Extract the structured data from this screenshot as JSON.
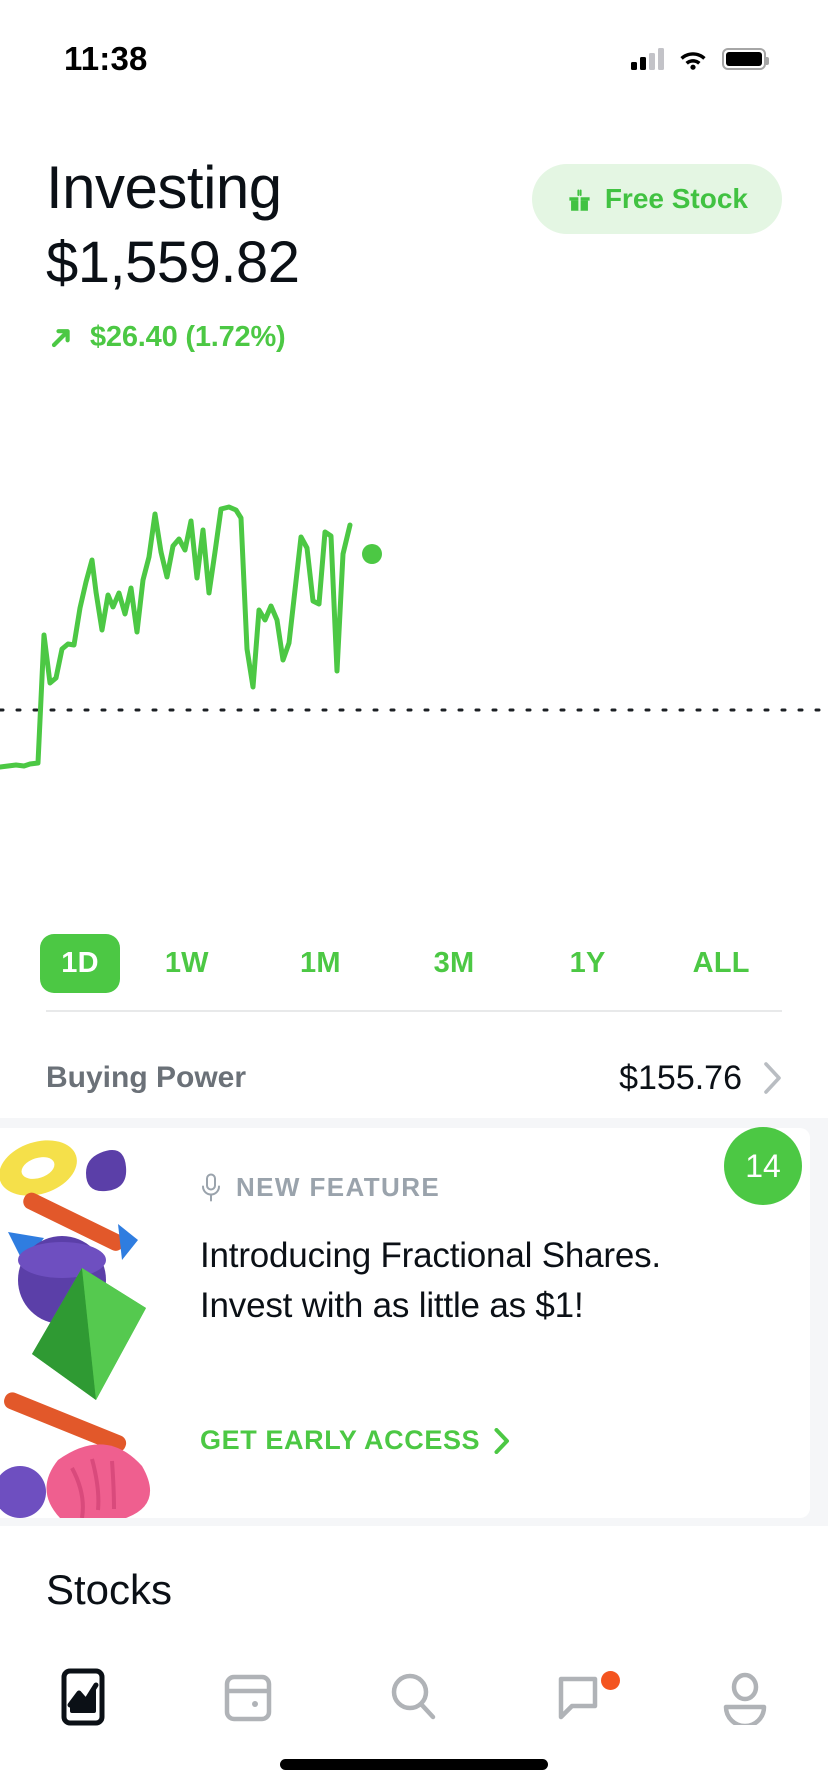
{
  "status_bar": {
    "time": "11:38",
    "cellular_icon": "cellular-signal-icon",
    "wifi_icon": "wifi-icon",
    "battery_icon": "battery-full-icon"
  },
  "header": {
    "title": "Investing",
    "portfolio_value": "$1,559.82",
    "change_arrow_icon": "arrow-up-right-icon",
    "change_text": "$26.40 (1.72%)",
    "change_color": "#4cc844",
    "free_stock_label": "Free Stock",
    "free_stock_icon": "gift-icon",
    "free_stock_bg": "#e4f6e3",
    "free_stock_fg": "#41c242"
  },
  "chart_data": {
    "type": "line",
    "title": "",
    "xlabel": "",
    "ylabel": "",
    "line_color": "#4cc844",
    "baseline_style": "dotted",
    "baseline_y_value": 1533.42,
    "grid": false,
    "legend": "none",
    "end_marker": true,
    "ylim": [
      1520,
      1580
    ],
    "xlim": [
      0,
      100
    ],
    "x": [
      0,
      1,
      2,
      3,
      4,
      5,
      6,
      7,
      8,
      9,
      10,
      11,
      12,
      13,
      14,
      15,
      16,
      17,
      18,
      19,
      20,
      21,
      22,
      23,
      24,
      25,
      26,
      27,
      28,
      29,
      30,
      31,
      32,
      33,
      34,
      35,
      36,
      37,
      38,
      39,
      40,
      41,
      42,
      43,
      44,
      45,
      46,
      47,
      48,
      49,
      50,
      51,
      52,
      53,
      54,
      55,
      56,
      57,
      58,
      59,
      60,
      61,
      62,
      63,
      64
    ],
    "values": [
      1531.3,
      1531.2,
      1531.2,
      1531.1,
      1531.1,
      1531.0,
      1544.6,
      1536.4,
      1537.3,
      1542.7,
      1543.4,
      1543.3,
      1550.2,
      1554.2,
      1558.2,
      1553.0,
      1546.2,
      1552.8,
      1551.2,
      1552.9,
      1549.7,
      1553.1,
      1545.6,
      1554.3,
      1558.0,
      1565.2,
      1558.8,
      1555.2,
      1559.5,
      1560.3,
      1558.7,
      1563.0,
      1553.5,
      1562.5,
      1552.3,
      1559.0,
      1566.0,
      1566.3,
      1565.8,
      1564.8,
      1544.2,
      1537.6,
      1549.8,
      1548.3,
      1550.3,
      1547.9,
      1542.3,
      1544.9,
      1553.9,
      1562.3,
      1560.6,
      1551.9,
      1551.4,
      1562.9,
      1562.3,
      1544.9,
      1559.8
    ]
  },
  "time_ranges": [
    {
      "label": "1D",
      "selected": true
    },
    {
      "label": "1W",
      "selected": false
    },
    {
      "label": "1M",
      "selected": false
    },
    {
      "label": "3M",
      "selected": false
    },
    {
      "label": "1Y",
      "selected": false
    },
    {
      "label": "ALL",
      "selected": false
    }
  ],
  "buying_power": {
    "label": "Buying Power",
    "value": "$155.76",
    "chevron_icon": "chevron-right-icon"
  },
  "feature_card": {
    "kicker_icon": "microphone-icon",
    "kicker": "NEW FEATURE",
    "headline": "Introducing Fractional Shares. Invest with as little as $1!",
    "cta_label": "GET EARLY ACCESS",
    "cta_icon": "chevron-right-icon",
    "badge_count": "14",
    "badge_color": "#4cc844",
    "art_name": "abstract-shapes-illustration"
  },
  "sections": {
    "stocks_heading": "Stocks"
  },
  "tab_bar": {
    "items": [
      {
        "name": "portfolio-tab",
        "icon": "portfolio-chart-icon",
        "active": true,
        "badge": false
      },
      {
        "name": "cash-tab",
        "icon": "wallet-icon",
        "active": false,
        "badge": false
      },
      {
        "name": "search-tab",
        "icon": "search-icon",
        "active": false,
        "badge": false
      },
      {
        "name": "messages-tab",
        "icon": "message-icon",
        "active": false,
        "badge": true
      },
      {
        "name": "account-tab",
        "icon": "person-icon",
        "active": false,
        "badge": false
      }
    ],
    "notification_dot_color": "#f4541f"
  }
}
